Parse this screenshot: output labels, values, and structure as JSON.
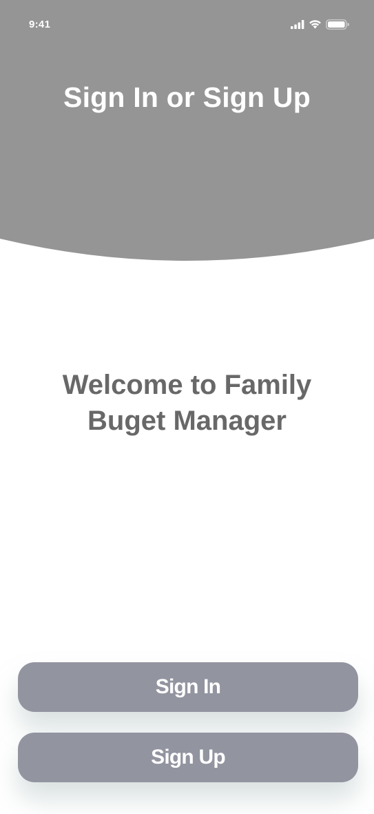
{
  "status_bar": {
    "time": "9:41"
  },
  "header": {
    "title": "Sign In or Sign Up"
  },
  "main": {
    "welcome_line1": "Welcome to Family",
    "welcome_line2": "Buget Manager"
  },
  "actions": {
    "sign_in_label": "Sign In",
    "sign_up_label": "Sign Up"
  },
  "colors": {
    "header_background": "#959595",
    "button_background": "#9294a0",
    "welcome_text": "#686868"
  },
  "icons": [
    "cellular-signal-icon",
    "wifi-icon",
    "battery-icon"
  ]
}
